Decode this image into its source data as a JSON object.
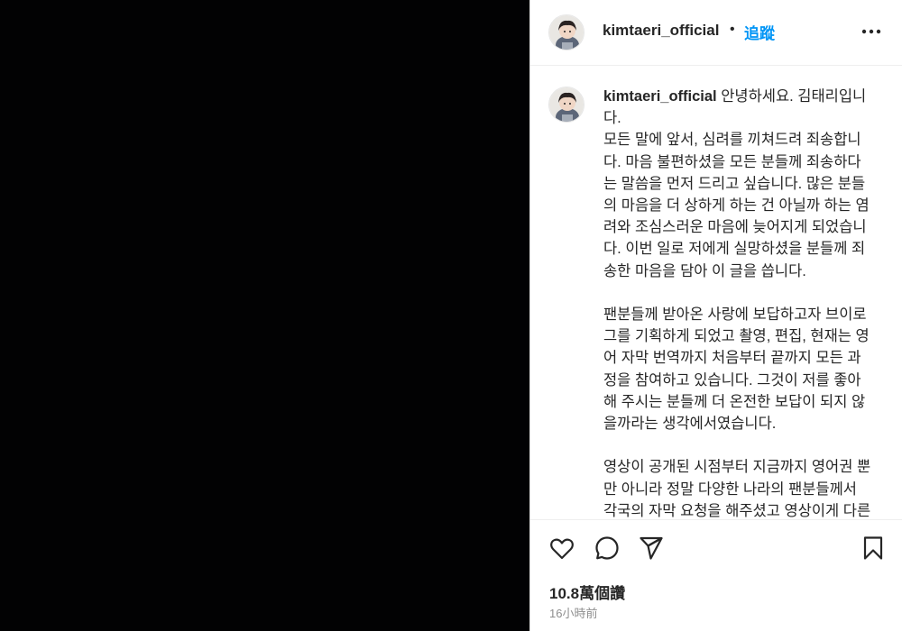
{
  "post": {
    "username": "kimtaeri_official",
    "separator": "•",
    "follow_label": "追蹤",
    "more_icon": "more-horizontal-icon"
  },
  "caption": {
    "username": "kimtaeri_official",
    "text": " 안녕하세요. 김태리입니다.\n모든 말에 앞서, 심려를 끼쳐드려 죄송합니다. 마음 불편하셨을 모든 분들께 죄송하다는 말씀을 먼저 드리고 싶습니다. 많은 분들의 마음을 더 상하게 하는 건 아닐까 하는 염려와 조심스러운 마음에 늦어지게 되었습니다. 이번 일로 저에게 실망하셨을 분들께 죄송한 마음을 담아 이 글을 씁니다.\n\n팬분들께 받아온 사랑에 보답하고자 브이로그를 기획하게 되었고 촬영, 편집, 현재는 영어 자막 번역까지 처음부터 끝까지 모든 과정을 참여하고 있습니다. 그것이 저를 좋아해 주시는 분들께 더 온전한 보답이 되지 않을까라는 생각에서였습니다.\n\n영상이 공개된 시점부터 지금까지 영어권 뿐만 아니라 정말 다양한 나라의 팬분들께서 각국의 자막 요청을 해주셨고 영상이게 다른 여러 언어들을 보며 이 분들이"
  },
  "actions": {
    "like_icon": "heart-icon",
    "comment_icon": "comment-icon",
    "share_icon": "share-icon",
    "save_icon": "bookmark-icon",
    "likes": "10.8萬個讚",
    "time": "16小時前"
  }
}
